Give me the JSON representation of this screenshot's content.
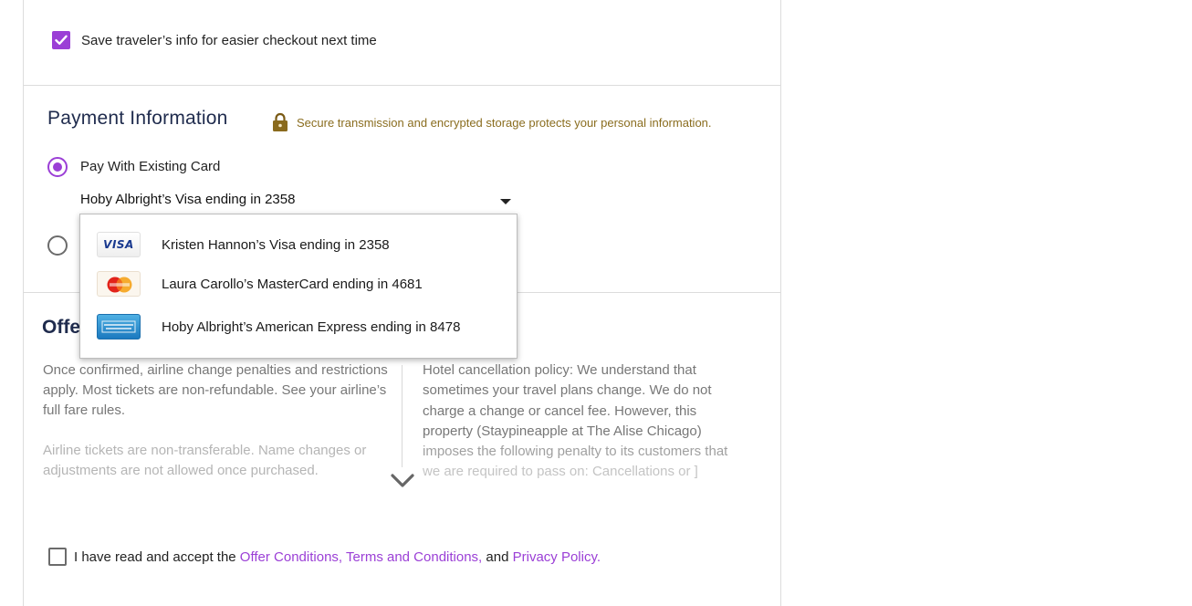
{
  "checkout": {
    "save_traveler_label": "Save traveler’s info for easier checkout next time",
    "save_traveler_checked": true
  },
  "payment": {
    "title": "Payment Information",
    "secure_text": "Secure transmission and encrypted storage protects your personal information.",
    "existing_card_label": "Pay With Existing Card",
    "selected_card": "Hoby Albright’s Visa ending in 2358",
    "dropdown_options": [
      {
        "brand": "visa",
        "brand_mark": "VISA",
        "label": "Kristen Hannon’s Visa ending in 2358"
      },
      {
        "brand": "mastercard",
        "brand_mark": "MasterCard",
        "label": "Laura Carollo’s MasterCard ending in 4681"
      },
      {
        "brand": "amex",
        "brand_mark": "AMERICAN EXPRESS",
        "label": "Hoby Albright’s American Express ending in 8478"
      }
    ]
  },
  "offer": {
    "title": "Offe",
    "left_para_1": "Once confirmed, airline change penalties and restrictions apply. Most tickets are non-refundable. See your airline’s full fare rules.",
    "left_para_2": "Airline tickets are non-transferable. Name changes or adjustments are not allowed once purchased.",
    "right_lines": [
      "Hotel cancellation policy: We understand that",
      "sometimes your travel plans change. We do not",
      "charge a change or cancel fee. However, this",
      "property (Staypineapple at The Alise Chicago)",
      "imposes the following penalty to its customers that",
      "we are required to pass on: Cancellations or ]"
    ]
  },
  "accept": {
    "prefix": "I have read and accept the ",
    "link_offer": "Offer Conditions,",
    "link_terms": "Terms and Conditions,",
    "and_text": "and",
    "link_privacy": "Privacy Policy.",
    "checked": false
  },
  "colors": {
    "accent": "#9b3fd6",
    "heading": "#1f2b4d",
    "secure_text": "#8a6d1f"
  }
}
